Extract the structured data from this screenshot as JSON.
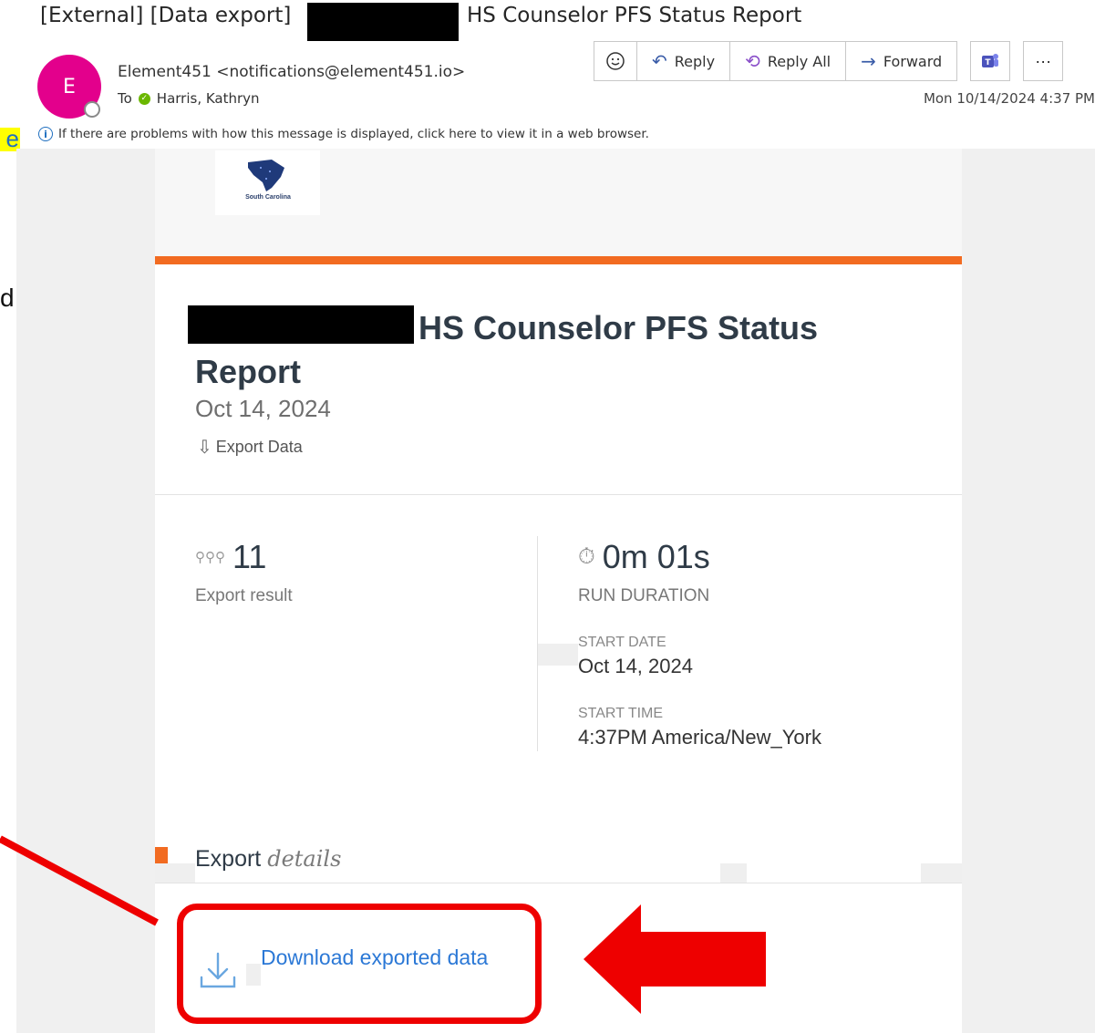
{
  "email": {
    "subject_prefix": "[External] [Data export]",
    "subject_suffix": "HS Counselor PFS Status Report",
    "avatar_initial": "E",
    "sender": "Element451 <notifications@element451.io>",
    "to_label": "To",
    "recipient": "Harris, Kathryn",
    "received": "Mon 10/14/2024 4:37 PM",
    "info_bar": "If there are problems with how this message is displayed, click here to view it in a web browser."
  },
  "toolbar": {
    "emoji_icon": "smiley-icon",
    "reply": "Reply",
    "reply_all": "Reply All",
    "forward": "Forward",
    "teams_icon": "teams-icon",
    "more": "···"
  },
  "edge_text": {
    "left_highlight": "e",
    "left_text": "d"
  },
  "report": {
    "logo_text": "South Carolina",
    "title": "HS Counselor PFS Status Report",
    "date": "Oct 14, 2024",
    "export_link": "Export Data",
    "export_count": "11",
    "export_count_label": "Export result",
    "run_duration": "0m 01s",
    "run_duration_label": "RUN DURATION",
    "start_date_label": "START DATE",
    "start_date": "Oct 14, 2024",
    "start_time_label": "START TIME",
    "start_time": "4:37PM America/New_York",
    "details_heading": "Export",
    "details_heading_em": "details",
    "download_link": "Download exported data"
  },
  "colors": {
    "accent_orange": "#f26b21",
    "annotation_red": "#ee0000",
    "link_blue": "#2b78d6",
    "avatar_pink": "#e3008c"
  }
}
